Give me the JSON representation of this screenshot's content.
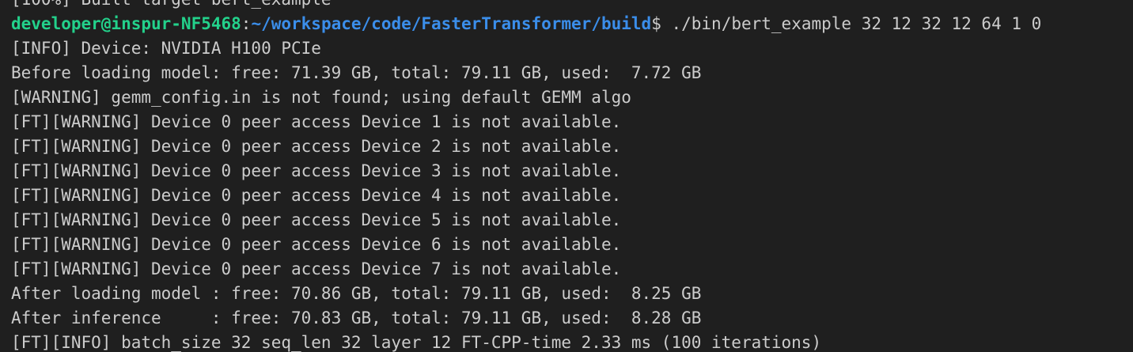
{
  "terminal": {
    "colors": {
      "background": "#1f1f1f",
      "foreground": "#cccccc",
      "prompt_user": "#23d18b",
      "prompt_path": "#3b8eea"
    },
    "cut_top_line": "[100%] Built target bert_example",
    "prompt": {
      "user_host": "developer@inspur-NF5468",
      "separator": ":",
      "path": "~/workspace/code/FasterTransformer/build",
      "dollar": "$",
      "command": " ./bin/bert_example 32 12 32 12 64 1 0"
    },
    "output_lines": [
      "[INFO] Device: NVIDIA H100 PCIe",
      "Before loading model: free: 71.39 GB, total: 79.11 GB, used:  7.72 GB",
      "[WARNING] gemm_config.in is not found; using default GEMM algo",
      "[FT][WARNING] Device 0 peer access Device 1 is not available.",
      "[FT][WARNING] Device 0 peer access Device 2 is not available.",
      "[FT][WARNING] Device 0 peer access Device 3 is not available.",
      "[FT][WARNING] Device 0 peer access Device 4 is not available.",
      "[FT][WARNING] Device 0 peer access Device 5 is not available.",
      "[FT][WARNING] Device 0 peer access Device 6 is not available.",
      "[FT][WARNING] Device 0 peer access Device 7 is not available.",
      "After loading model : free: 70.86 GB, total: 79.11 GB, used:  8.25 GB",
      "After inference     : free: 70.83 GB, total: 79.11 GB, used:  8.28 GB",
      "[FT][INFO] batch_size 32 seq_len 32 layer 12 FT-CPP-time 2.33 ms (100 iterations)"
    ]
  }
}
